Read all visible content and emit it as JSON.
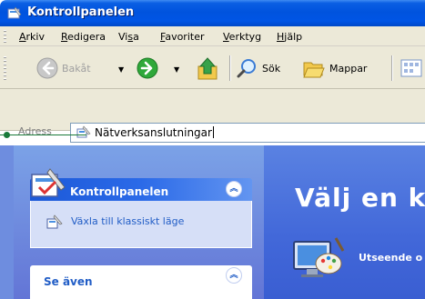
{
  "window": {
    "title": "Kontrollpanelen"
  },
  "menu": {
    "items": [
      {
        "accel": "A",
        "rest": "rkiv"
      },
      {
        "accel": "R",
        "rest": "edigera"
      },
      {
        "prefix": "Vi",
        "accel": "s",
        "rest": "a"
      },
      {
        "accel": "F",
        "rest": "avoriter"
      },
      {
        "accel": "V",
        "rest": "erktyg"
      },
      {
        "accel": "H",
        "rest": "jälp"
      }
    ]
  },
  "toolbar": {
    "back_label": "Bakåt",
    "search_label": "Sök",
    "folders_label": "Mappar"
  },
  "address": {
    "label": "Adress",
    "value": "Nätverksanslutningar"
  },
  "taskpane": {
    "panel1_title": "Kontrollpanelen",
    "panel1_link": "Växla till klassiskt läge",
    "panel2_title": "Se även"
  },
  "content": {
    "title": "Välj en k",
    "item1_label": "Utseende o"
  },
  "colors": {
    "titlebar": "#0055e5",
    "pane_left": "#7ba2e7",
    "pane_right": "#4268d9",
    "link": "#215dc6"
  }
}
